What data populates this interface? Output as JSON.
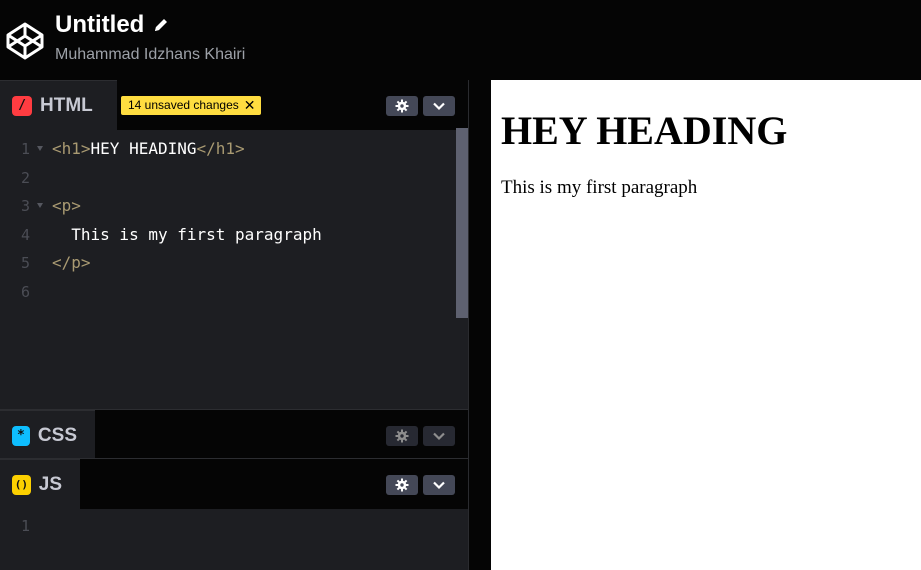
{
  "header": {
    "title": "Untitled",
    "author": "Muhammad Idzhans Khairi",
    "logo_icon": "codepen-logo-icon",
    "edit_icon": "pencil-icon"
  },
  "panes": {
    "html": {
      "label": "HTML",
      "icon_glyph": "/",
      "icon_color": "#ff3c41",
      "unsaved_badge": "14 unsaved changes",
      "badge_close": "✕",
      "line_numbers": [
        "1",
        "2",
        "3",
        "4",
        "5",
        "6"
      ],
      "code": {
        "l1_open": "<h1>",
        "l1_text": "HEY HEADING",
        "l1_close": "</h1>",
        "l3_open": "<p>",
        "l4_text": "  This is my first paragraph",
        "l5_close": "</p>"
      }
    },
    "css": {
      "label": "CSS",
      "icon_glyph": "*",
      "icon_color": "#0ebeff"
    },
    "js": {
      "label": "JS",
      "icon_glyph": "()",
      "icon_color": "#fcd000",
      "line_numbers": [
        "1"
      ]
    }
  },
  "preview": {
    "heading": "HEY HEADING",
    "paragraph": "This is my first paragraph"
  },
  "colors": {
    "editor_bg": "#1d1e22",
    "header_bg": "#050505",
    "badge_bg": "#ffdd40",
    "tag_color": "#a99a72",
    "control_bg": "#444857"
  }
}
